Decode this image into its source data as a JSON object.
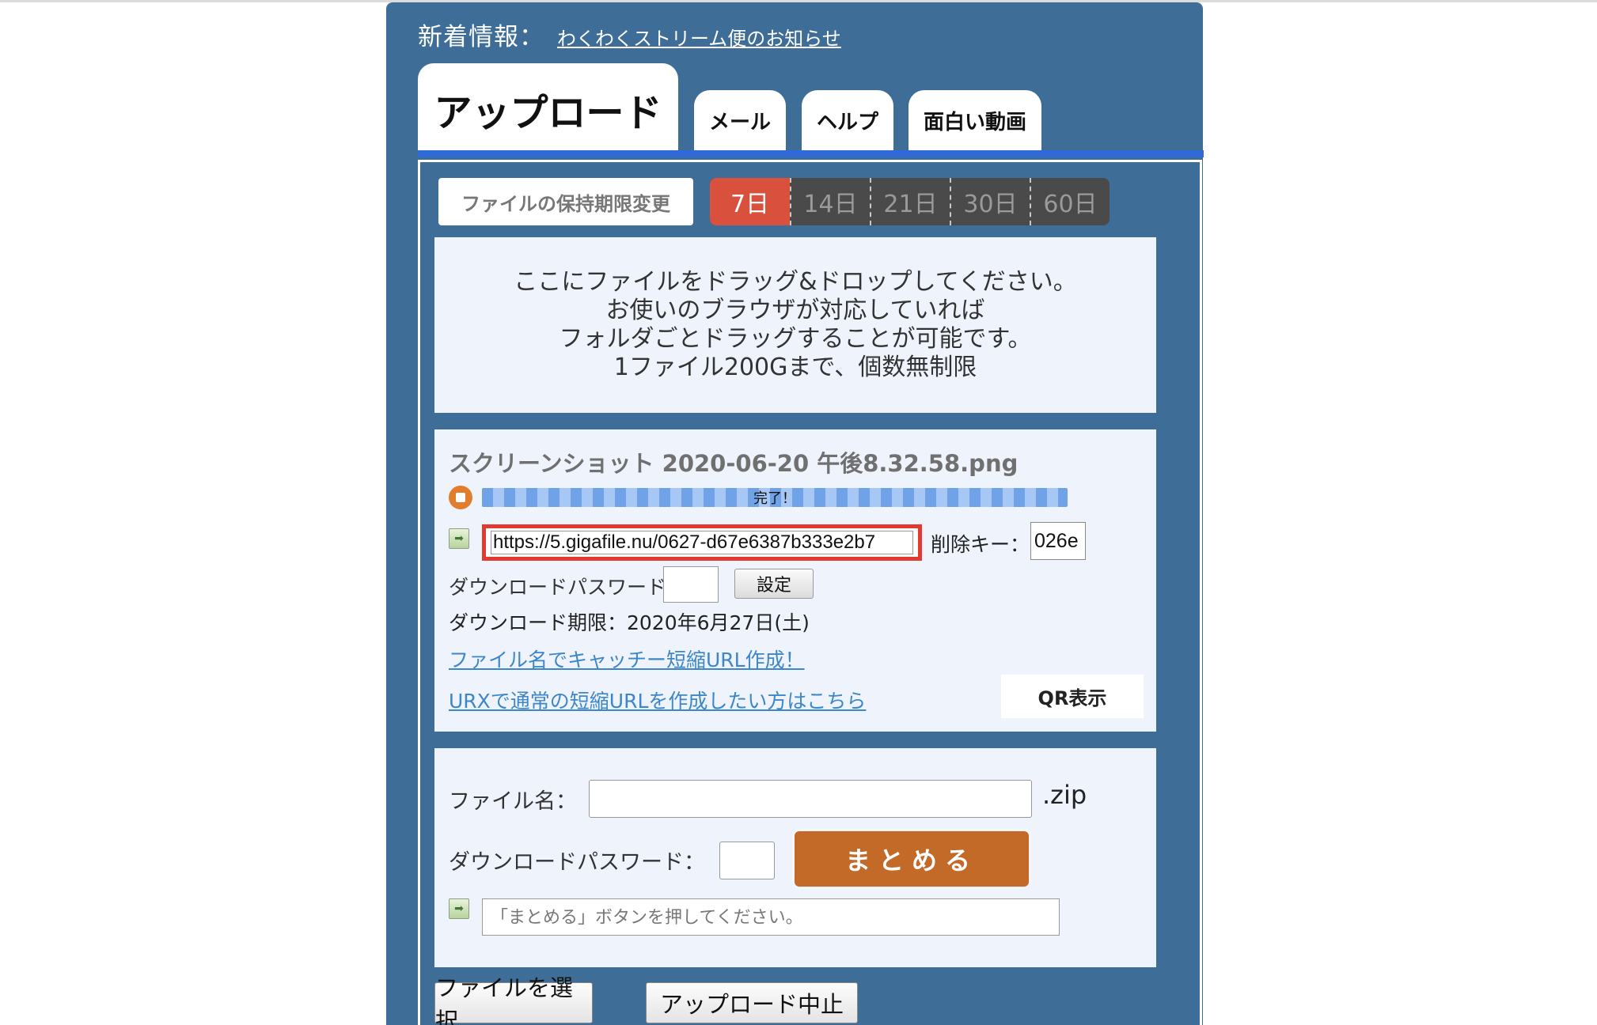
{
  "news": {
    "label": "新着情報：",
    "link": "わくわくストリーム便のお知らせ"
  },
  "tabs": {
    "upload": "アップロード",
    "mail": "メール",
    "help": "ヘルプ",
    "video": "面白い動画"
  },
  "retention": {
    "label": "ファイルの保持期限変更",
    "options": [
      "7日",
      "14日",
      "21日",
      "30日",
      "60日"
    ],
    "selected": "7日"
  },
  "dropzone": {
    "lines": [
      "ここにファイルをドラッグ&ドロップしてください。",
      "お使いのブラウザが対応していれば",
      "フォルダごとドラッグすることが可能です。",
      "1ファイル200Gまで、個数無制限"
    ]
  },
  "file": {
    "name": "スクリーンショット 2020-06-20 午後8.32.58.png",
    "progress_text": "完了！",
    "progress": 1.0,
    "url": "https://5.gigafile.nu/0627-d67e6387b333e2b7",
    "delete_key_label": "削除キー：",
    "delete_key": "026e",
    "download_password_label": "ダウンロードパスワード：",
    "set_button": "設定",
    "download_limit": "ダウンロード期限：2020年6月27日(土)",
    "catchy_link": "ファイル名でキャッチー短縮URL作成！",
    "urx_link": "URXで通常の短縮URLを作成したい方はこちら",
    "qr_button": "QR表示"
  },
  "zip": {
    "filename_label": "ファイル名：",
    "filename_value": "",
    "extension": ".zip",
    "password_label": "ダウンロードパスワード：",
    "combine_button": "まとめる",
    "result_placeholder": "「まとめる」ボタンを押してください。"
  },
  "bottom": {
    "select_button": "ファイルを選択",
    "cancel_button": "アップロード中止"
  },
  "colors": {
    "panel": "#3e6e98",
    "tab_strip": "#2f6ad6",
    "selected_day": "#d9503d",
    "combine_button": "#c36a28",
    "highlight": "#e23a2e",
    "link": "#3d86c8"
  }
}
